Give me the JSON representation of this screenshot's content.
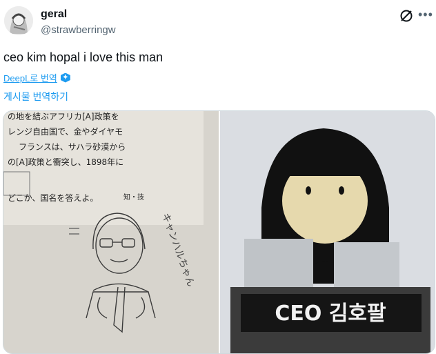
{
  "author": {
    "display_name": "geral",
    "handle": "@strawberringw"
  },
  "tweet": {
    "text": "ceo kim hopal i love this man"
  },
  "translation": {
    "deepl_label": "DeepL로 번역",
    "translate_post_label": "게시물 번역하기"
  },
  "media": {
    "left_image": {
      "text_lines": [
        "の地を結ぶアフリカ[A]政策を",
        "レンジ自由国で、金やダイヤモ",
        "フランスは、サハラ砂漠から",
        "の[A]政策と衝突し、1898年に",
        "どこか、国名を答えよ。",
        "知・技",
        "キャンハルちゃん"
      ]
    },
    "right_image": {
      "nameplate": "CEO 김호팔"
    }
  },
  "colors": {
    "accent": "#1d9bf0",
    "text": "#0f1419",
    "secondary": "#536471"
  },
  "icons": {
    "grok": "grok-icon",
    "more": "more-icon",
    "deepl": "deepl-icon"
  }
}
